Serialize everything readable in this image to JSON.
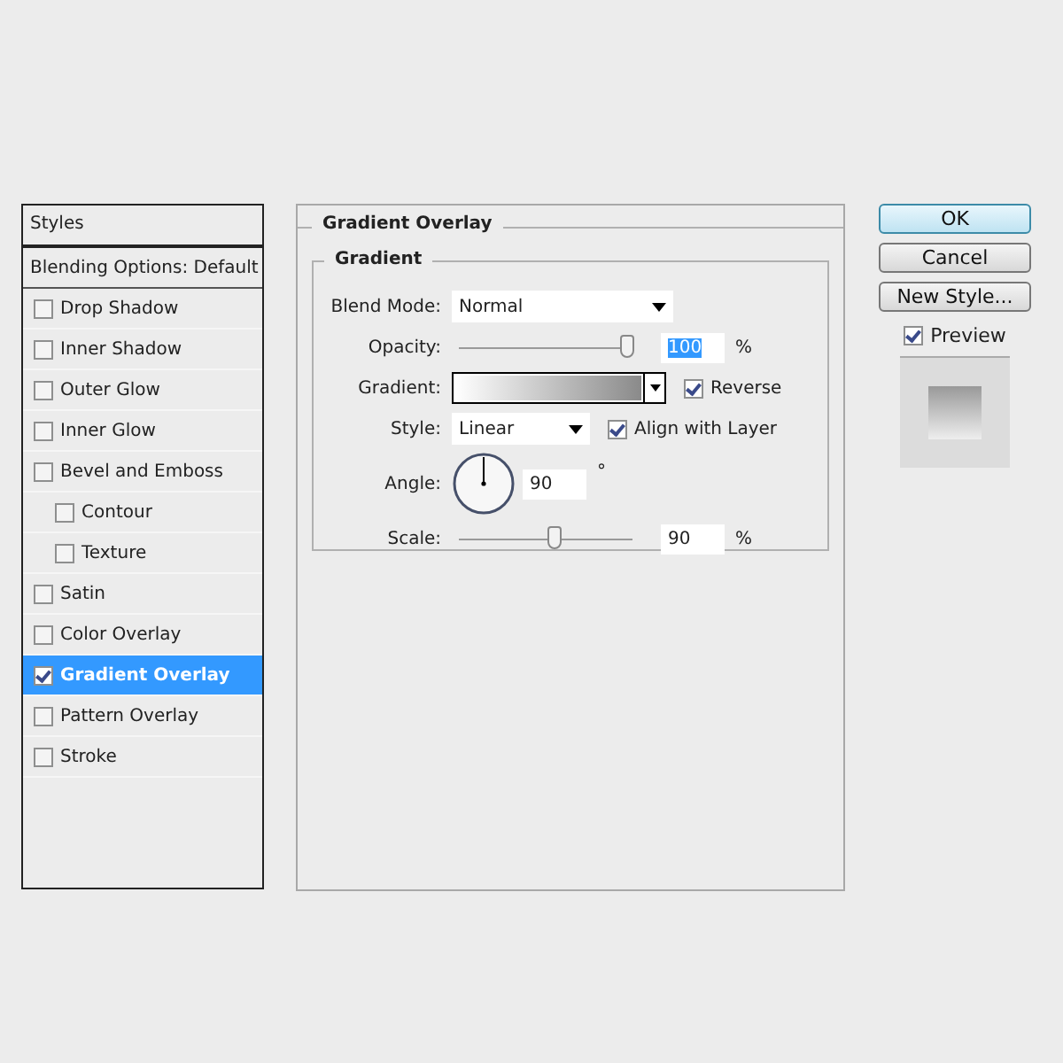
{
  "styles_panel": {
    "header": "Styles",
    "blending_options": "Blending Options: Default",
    "items": [
      {
        "label": "Drop Shadow",
        "checked": false,
        "selected": false
      },
      {
        "label": "Inner Shadow",
        "checked": false,
        "selected": false
      },
      {
        "label": "Outer Glow",
        "checked": false,
        "selected": false
      },
      {
        "label": "Inner Glow",
        "checked": false,
        "selected": false
      },
      {
        "label": "Bevel and Emboss",
        "checked": false,
        "selected": false,
        "children": [
          {
            "label": "Contour",
            "checked": false,
            "selected": false
          },
          {
            "label": "Texture",
            "checked": false,
            "selected": false
          }
        ]
      },
      {
        "label": "Satin",
        "checked": false,
        "selected": false
      },
      {
        "label": "Color Overlay",
        "checked": false,
        "selected": false
      },
      {
        "label": "Gradient Overlay",
        "checked": true,
        "selected": true
      },
      {
        "label": "Pattern Overlay",
        "checked": false,
        "selected": false
      },
      {
        "label": "Stroke",
        "checked": false,
        "selected": false
      }
    ]
  },
  "settings": {
    "title": "Gradient Overlay",
    "group": "Gradient",
    "blend_mode": {
      "label": "Blend Mode:",
      "value": "Normal"
    },
    "opacity": {
      "label": "Opacity:",
      "level": 0.97,
      "value": "100",
      "unit": "%"
    },
    "gradient": {
      "label": "Gradient:",
      "reverse": {
        "label": "Reverse",
        "checked": true
      }
    },
    "style": {
      "label": "Style:",
      "value": "Linear",
      "align": {
        "label": "Align with Layer",
        "checked": true
      }
    },
    "angle": {
      "label": "Angle:",
      "value": "90",
      "unit": "°"
    },
    "scale": {
      "label": "Scale:",
      "level": 0.55,
      "value": "90",
      "unit": "%"
    }
  },
  "buttons": [
    {
      "label": "OK",
      "default": true
    },
    {
      "label": "Cancel",
      "default": false
    },
    {
      "label": "New Style...",
      "default": false
    }
  ],
  "preview": {
    "label": "Preview",
    "checked": true
  }
}
